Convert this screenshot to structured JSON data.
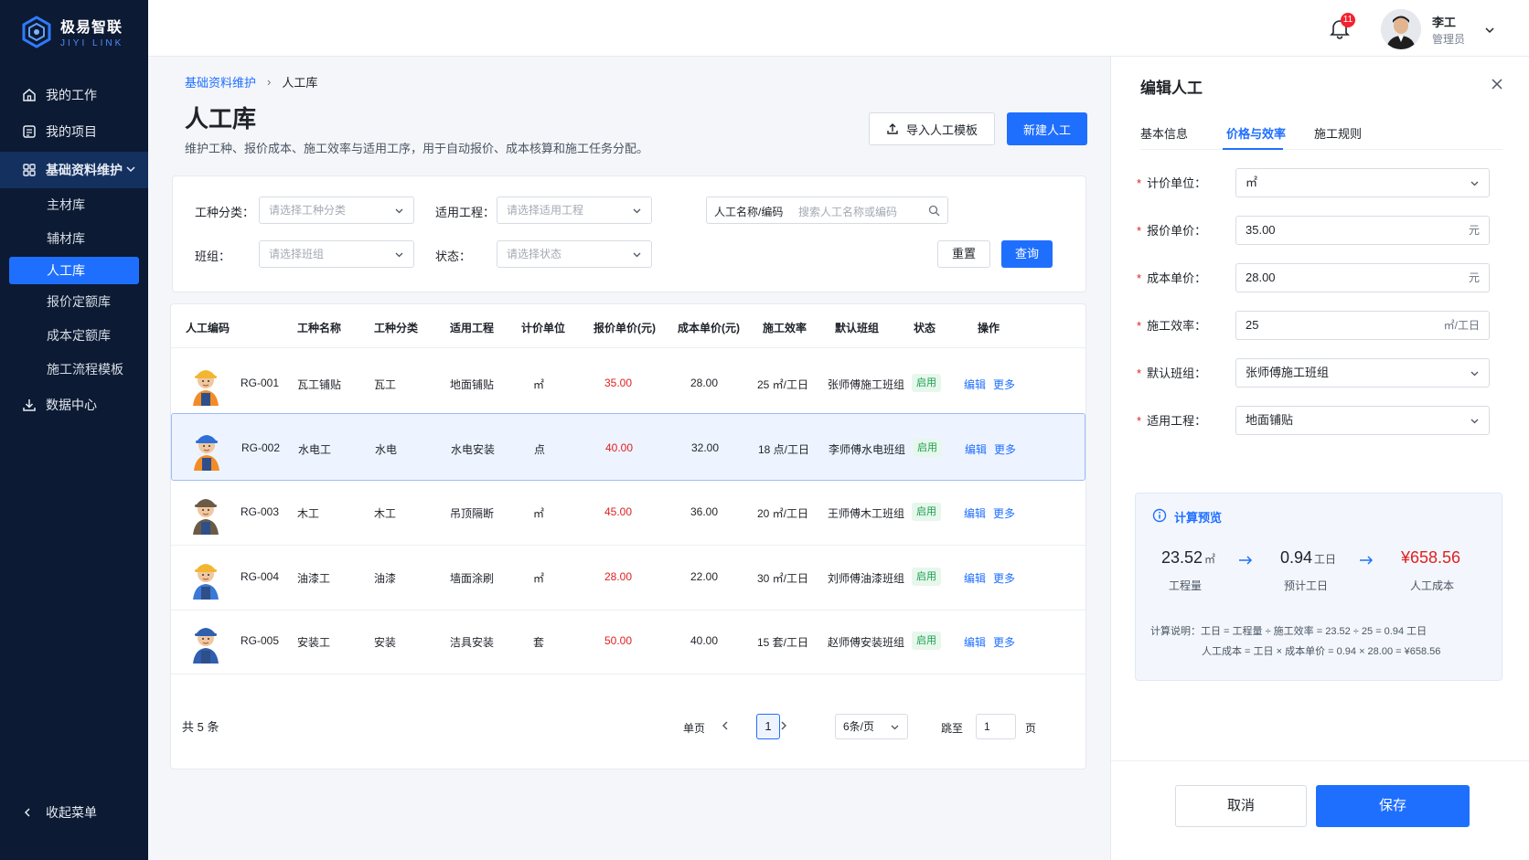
{
  "brand": {
    "name": "极易智联",
    "subtitle": "JIYI LINK"
  },
  "sidebar": {
    "items": [
      {
        "label": "我的工作",
        "icon": "home-icon"
      },
      {
        "label": "我的项目",
        "icon": "project-icon"
      }
    ],
    "group": {
      "label": "基础资料维护",
      "icon": "grid-icon"
    },
    "sub_items": [
      {
        "label": "主材库"
      },
      {
        "label": "辅材库"
      },
      {
        "label": "人工库"
      },
      {
        "label": "报价定额库"
      },
      {
        "label": "成本定额库"
      },
      {
        "label": "施工流程模板"
      }
    ],
    "data_center": {
      "label": "数据中心",
      "icon": "download-icon"
    },
    "collapse_label": "收起菜单"
  },
  "header": {
    "notification_count": "11",
    "user_name": "李工",
    "user_role": "管理员"
  },
  "breadcrumb": {
    "parent": "基础资料维护",
    "separator": "›",
    "current": "人工库"
  },
  "page": {
    "title": "人工库",
    "description": "维护工种、报价成本、施工效率与适用工序，用于自动报价、成本核算和施工任务分配。",
    "import_label": "导入人工模板",
    "new_label": "新建人工"
  },
  "filters": {
    "work_type": {
      "label": "工种分类：",
      "placeholder": "请选择工种分类"
    },
    "project": {
      "label": "适用工程：",
      "placeholder": "请选择适用工程"
    },
    "search": {
      "label": "人工名称/编码",
      "placeholder": "搜索人工名称或编码"
    },
    "team": {
      "label": "班组：",
      "placeholder": "请选择班组"
    },
    "status": {
      "label": "状态：",
      "placeholder": "请选择状态"
    },
    "reset_label": "重置",
    "query_label": "查询"
  },
  "table": {
    "columns": [
      "人工编码",
      "工种名称",
      "工种分类",
      "适用工程",
      "计价单位",
      "报价单价(元)",
      "成本单价(元)",
      "施工效率",
      "默认班组",
      "状态",
      "操作"
    ],
    "rows": [
      {
        "code": "RG-001",
        "name": "瓦工铺贴",
        "category": "瓦工",
        "project": "地面铺贴",
        "unit": "㎡",
        "quote": "35.00",
        "cost": "28.00",
        "efficiency": "25 ㎡/工日",
        "team": "张师傅施工班组",
        "status": "启用",
        "edit": "编辑",
        "more": "更多",
        "hat": "#f2b632",
        "shirt": "#f28c28"
      },
      {
        "code": "RG-002",
        "name": "水电工",
        "category": "水电",
        "project": "水电安装",
        "unit": "点",
        "quote": "40.00",
        "cost": "32.00",
        "efficiency": "18 点/工日",
        "team": "李师傅水电班组",
        "status": "启用",
        "edit": "编辑",
        "more": "更多",
        "hat": "#2f6fd6",
        "shirt": "#f28c28"
      },
      {
        "code": "RG-003",
        "name": "木工",
        "category": "木工",
        "project": "吊顶隔断",
        "unit": "㎡",
        "quote": "45.00",
        "cost": "36.00",
        "efficiency": "20 ㎡/工日",
        "team": "王师傅木工班组",
        "status": "启用",
        "edit": "编辑",
        "more": "更多",
        "hat": "#6b5a46",
        "shirt": "#6b5a46"
      },
      {
        "code": "RG-004",
        "name": "油漆工",
        "category": "油漆",
        "project": "墙面涂刷",
        "unit": "㎡",
        "quote": "28.00",
        "cost": "22.00",
        "efficiency": "30 ㎡/工日",
        "team": "刘师傅油漆班组",
        "status": "启用",
        "edit": "编辑",
        "more": "更多",
        "hat": "#f2b632",
        "shirt": "#3a79d6"
      },
      {
        "code": "RG-005",
        "name": "安装工",
        "category": "安装",
        "project": "洁具安装",
        "unit": "套",
        "quote": "50.00",
        "cost": "40.00",
        "efficiency": "15 套/工日",
        "team": "赵师傅安装班组",
        "status": "启用",
        "edit": "编辑",
        "more": "更多",
        "hat": "#2f5fae",
        "shirt": "#2f5fae"
      }
    ]
  },
  "pagination": {
    "total": "共 5 条",
    "single_page": "单页",
    "current_page": "1",
    "page_size": "6条/页",
    "jump_label": "跳至",
    "jump_value": "1",
    "page_suffix": "页"
  },
  "panel": {
    "title": "编辑人工",
    "tabs": [
      "基本信息",
      "价格与效率",
      "施工规则"
    ],
    "fields": {
      "unit": {
        "label": "计价单位：",
        "value": "㎡"
      },
      "quote": {
        "label": "报价单价：",
        "value": "35.00",
        "suffix": "元"
      },
      "cost": {
        "label": "成本单价：",
        "value": "28.00",
        "suffix": "元"
      },
      "efficiency": {
        "label": "施工效率：",
        "value": "25",
        "suffix": "㎡/工日"
      },
      "team": {
        "label": "默认班组：",
        "value": "张师傅施工班组"
      },
      "project": {
        "label": "适用工程：",
        "value": "地面铺贴"
      }
    },
    "preview": {
      "title": "计算预览",
      "quantity": "23.52",
      "quantity_unit": "㎡",
      "quantity_label": "工程量",
      "days": "0.94",
      "days_unit": "工日",
      "days_label": "预计工日",
      "cost": "¥658.56",
      "cost_label": "人工成本",
      "note_line1": "计算说明：工日 = 工程量 ÷ 施工效率 = 23.52 ÷ 25 = 0.94 工日",
      "note_line2": "人工成本 = 工日 × 成本单价 = 0.94 × 28.00 = ¥658.56"
    },
    "cancel_label": "取消",
    "save_label": "保存"
  },
  "colors": {
    "accent": "#1f6fff",
    "sidebar_bg": "#0c1a33",
    "price_red": "#e02020",
    "status_green": "#1a9f4f"
  }
}
